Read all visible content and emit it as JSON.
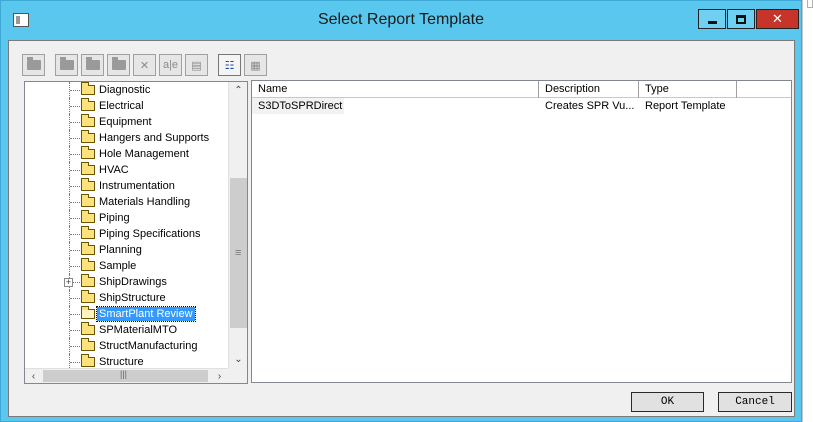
{
  "window": {
    "title": "Select Report Template",
    "controls": {
      "minimize": "minimize",
      "maximize": "maximize",
      "close": "✕"
    }
  },
  "toolbar": {
    "rename_glyph": "a|e"
  },
  "tree": {
    "items": [
      {
        "label": "Diagnostic",
        "expandable": false,
        "selected": false
      },
      {
        "label": "Electrical",
        "expandable": false,
        "selected": false
      },
      {
        "label": "Equipment",
        "expandable": false,
        "selected": false
      },
      {
        "label": "Hangers and Supports",
        "expandable": false,
        "selected": false
      },
      {
        "label": "Hole Management",
        "expandable": false,
        "selected": false
      },
      {
        "label": "HVAC",
        "expandable": false,
        "selected": false
      },
      {
        "label": "Instrumentation",
        "expandable": false,
        "selected": false
      },
      {
        "label": "Materials Handling",
        "expandable": false,
        "selected": false
      },
      {
        "label": "Piping",
        "expandable": false,
        "selected": false
      },
      {
        "label": "Piping Specifications",
        "expandable": false,
        "selected": false
      },
      {
        "label": "Planning",
        "expandable": false,
        "selected": false
      },
      {
        "label": "Sample",
        "expandable": false,
        "selected": false
      },
      {
        "label": "ShipDrawings",
        "expandable": true,
        "selected": false
      },
      {
        "label": "ShipStructure",
        "expandable": false,
        "selected": false
      },
      {
        "label": "SmartPlant Review",
        "expandable": false,
        "selected": true
      },
      {
        "label": "SPMaterialMTO",
        "expandable": false,
        "selected": false
      },
      {
        "label": "StructManufacturing",
        "expandable": false,
        "selected": false
      },
      {
        "label": "Structure",
        "expandable": false,
        "selected": false
      }
    ]
  },
  "list": {
    "columns": [
      "Name",
      "Description",
      "Type"
    ],
    "rows": [
      {
        "name": "S3DToSPRDirect",
        "description": "Creates SPR Vu...",
        "type": "Report Template"
      }
    ]
  },
  "buttons": {
    "ok": "OK",
    "cancel": "Cancel"
  }
}
